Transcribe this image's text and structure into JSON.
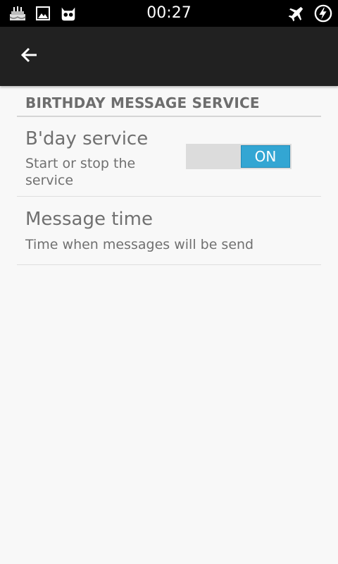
{
  "status_bar": {
    "time": "00:27",
    "icons_left": [
      "birthday-cake-icon",
      "gallery-icon",
      "cyanogen-mascot-icon"
    ],
    "icons_right": [
      "airplane-mode-icon",
      "charging-icon"
    ]
  },
  "action_bar": {
    "back_icon": "back-arrow-icon"
  },
  "section": {
    "title": "BIRTHDAY MESSAGE SERVICE"
  },
  "prefs": [
    {
      "title": "B'day service",
      "summary": "Start or stop the service",
      "toggle": {
        "state": "ON",
        "on": true
      }
    },
    {
      "title": "Message time",
      "summary": "Time when messages will be send"
    }
  ],
  "colors": {
    "accent": "#33a6d3",
    "action_bar": "#212121",
    "text": "#707070"
  }
}
